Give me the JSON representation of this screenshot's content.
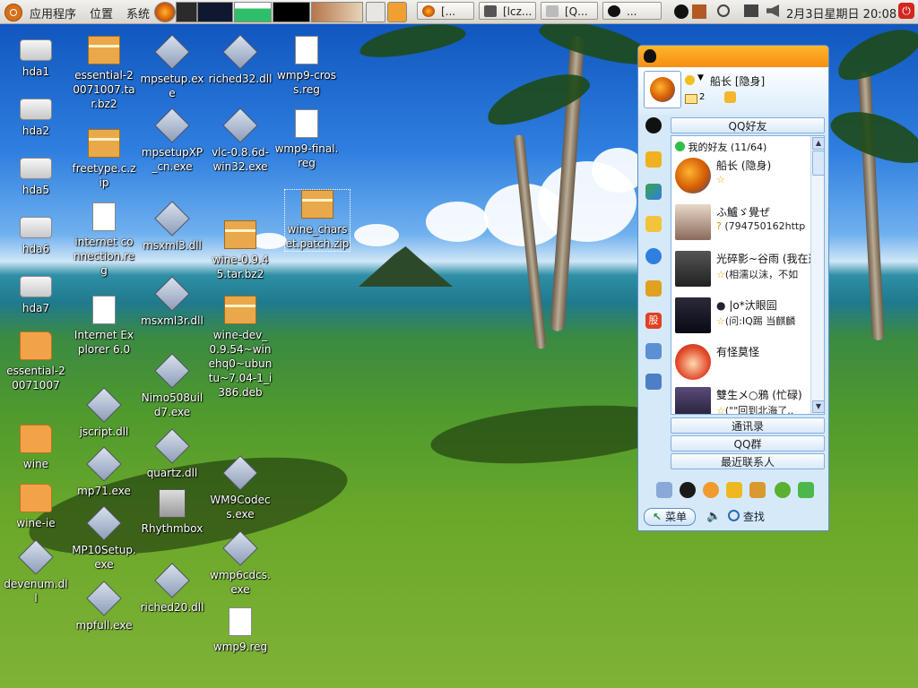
{
  "panel": {
    "menus": [
      "应用程序",
      "位置",
      "系统"
    ],
    "tasks": [
      "[...",
      "[lcz...",
      "[Q...",
      "..."
    ],
    "clock": "2月3日星期日 20:08"
  },
  "desktop_icons": [
    {
      "label": "hda1",
      "kind": "drive"
    },
    {
      "label": "hda2",
      "kind": "drive"
    },
    {
      "label": "hda5",
      "kind": "drive"
    },
    {
      "label": "hda6",
      "kind": "drive"
    },
    {
      "label": "hda7",
      "kind": "drive"
    },
    {
      "label": "essential-20071007",
      "kind": "folder"
    },
    {
      "label": "wine",
      "kind": "folder"
    },
    {
      "label": "wine-ie",
      "kind": "folder"
    },
    {
      "label": "devenum.dll",
      "kind": "dll"
    },
    {
      "label": "essential-20071007.tar.bz2",
      "kind": "box"
    },
    {
      "label": "freetype.c.zip",
      "kind": "box"
    },
    {
      "label": "internet connection.reg",
      "kind": "doc"
    },
    {
      "label": "Internet Explorer 6.0",
      "kind": "doc"
    },
    {
      "label": "jscript.dll",
      "kind": "dll"
    },
    {
      "label": "mp71.exe",
      "kind": "dll"
    },
    {
      "label": "MP10Setup.exe",
      "kind": "dll"
    },
    {
      "label": "mpfull.exe",
      "kind": "dll"
    },
    {
      "label": "mpsetup.exe",
      "kind": "dll"
    },
    {
      "label": "mpsetupXP_cn.exe",
      "kind": "dll"
    },
    {
      "label": "msxml3.dll",
      "kind": "dll"
    },
    {
      "label": "msxml3r.dll",
      "kind": "dll"
    },
    {
      "label": "Nimo508uild7.exe",
      "kind": "dll"
    },
    {
      "label": "quartz.dll",
      "kind": "dll"
    },
    {
      "label": "Rhythmbox",
      "kind": "rb"
    },
    {
      "label": "riched20.dll",
      "kind": "dll"
    },
    {
      "label": "riched32.dll",
      "kind": "dll"
    },
    {
      "label": "vlc-0.8.6d-win32.exe",
      "kind": "dll"
    },
    {
      "label": "wine-0.9.45.tar.bz2",
      "kind": "box"
    },
    {
      "label": "wine-dev_0.9.54~winehq0~ubuntu~7.04-1_i386.deb",
      "kind": "box"
    },
    {
      "label": "WM9Codecs.exe",
      "kind": "dll"
    },
    {
      "label": "wmp6cdcs.exe",
      "kind": "dll"
    },
    {
      "label": "wmp9.reg",
      "kind": "doc"
    },
    {
      "label": "wmp9-cross.reg",
      "kind": "doc"
    },
    {
      "label": "wmp9-final.reg",
      "kind": "doc"
    },
    {
      "label": "wine_charset.patch.zip",
      "kind": "box"
    }
  ],
  "qq": {
    "user_name": "船长 [隐身]",
    "mail_count": "2",
    "tab_friends": "QQ好友",
    "group_header": "我的好友 (11/64)",
    "friends": [
      {
        "name": "船长 (隐身)",
        "status": ""
      },
      {
        "name": "ふ鱸ゞ覺ぜ",
        "status": "(794750162http"
      },
      {
        "name": "光碎影~谷雨 (我在这",
        "status": "(相濡以沫，不如"
      },
      {
        "name": "|o*汏眼囩",
        "status": "(问:IQ踢 当麒麟"
      },
      {
        "name": "有怪莫怪",
        "status": ""
      },
      {
        "name": "雙生メ○鴉 (忙碌)",
        "status": "(\"\"回到北海了.."
      }
    ],
    "tab_contacts": "通讯录",
    "tab_groups": "QQ群",
    "tab_recent": "最近联系人",
    "menu_label": "菜单",
    "find_label": "查找"
  }
}
